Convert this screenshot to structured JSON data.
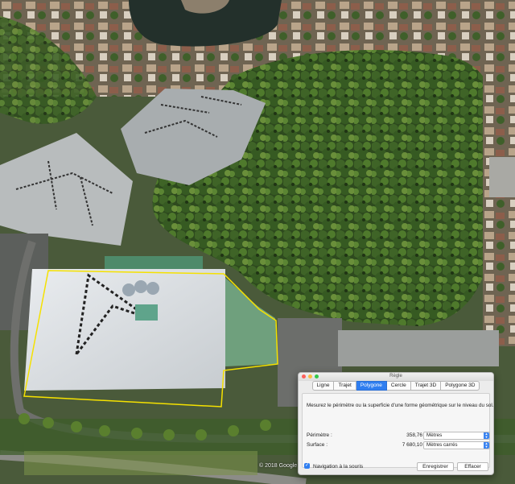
{
  "map": {
    "credit": "© 2018 Google"
  },
  "ruler": {
    "title": "Règle",
    "tabs": [
      "Ligne",
      "Trajet",
      "Polygone",
      "Cercle",
      "Trajet 3D",
      "Polygone 3D"
    ],
    "active_tab": "Polygone",
    "description": "Mesurez le périmètre ou la superficie d'une forme géométrique sur le niveau du sol.",
    "perimeter": {
      "label": "Périmètre :",
      "value": "358,76",
      "unit": "Mètres"
    },
    "area": {
      "label": "Surface :",
      "value": "7 680,10",
      "unit": "Mètres carrés"
    },
    "mouse_nav": {
      "label": "Navigation à la souris",
      "checked": true
    },
    "save_label": "Enregistrer",
    "clear_label": "Effacer"
  },
  "colors": {
    "polygon_outline": "#f5e100",
    "active_tab": "#2f7ef0",
    "close": "#fc615d",
    "minimize": "#fdbc40",
    "maximize": "#34c84a"
  }
}
